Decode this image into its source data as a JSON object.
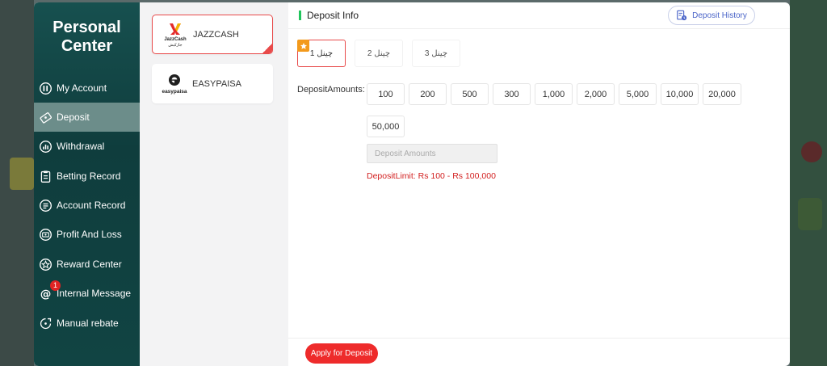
{
  "sidebar": {
    "title_line1": "Personal",
    "title_line2": "Center",
    "items": [
      {
        "label": "My Account"
      },
      {
        "label": "Deposit"
      },
      {
        "label": "Withdrawal"
      },
      {
        "label": "Betting Record"
      },
      {
        "label": "Account Record"
      },
      {
        "label": "Profit And Loss"
      },
      {
        "label": "Reward Center"
      },
      {
        "label": "Internal Message",
        "badge": "1"
      },
      {
        "label": "Manual rebate"
      }
    ],
    "active_index": 1
  },
  "methods": [
    {
      "label": "JAZZCASH",
      "active": true,
      "logo_text_1": "JazzCash",
      "logo_text_2": "جازکیش"
    },
    {
      "label": "EASYPAISA",
      "active": false,
      "logo_text_1": "easypaisa"
    }
  ],
  "main": {
    "header_title": "Deposit Info",
    "history_label": "Deposit History",
    "channels": [
      "چینل 1",
      "چینل 2",
      "چینل 3"
    ],
    "active_channel": 0,
    "amount_label": "DepositAmounts:",
    "amounts": [
      "100",
      "200",
      "500",
      "300",
      "1,000",
      "2,000",
      "5,000",
      "10,000",
      "20,000",
      "50,000"
    ],
    "input_placeholder": "Deposit Amounts",
    "limit_text": "DepositLimit:  Rs  100  -  Rs  100,000",
    "apply_label": "Apply for Deposit"
  },
  "colors": {
    "accent_red": "#ee2b2b",
    "sidebar_teal": "#0f3d3d",
    "active_nav": "#6c8d8a",
    "link_blue": "#4a64c8",
    "green_bar": "#21c55d"
  },
  "icons": [
    "user-circle-icon",
    "deposit-icon",
    "withdrawal-icon",
    "betting-record-icon",
    "account-record-icon",
    "profit-loss-icon",
    "reward-icon",
    "at-sign-icon",
    "rebate-icon",
    "history-icon",
    "star-flag-icon"
  ]
}
